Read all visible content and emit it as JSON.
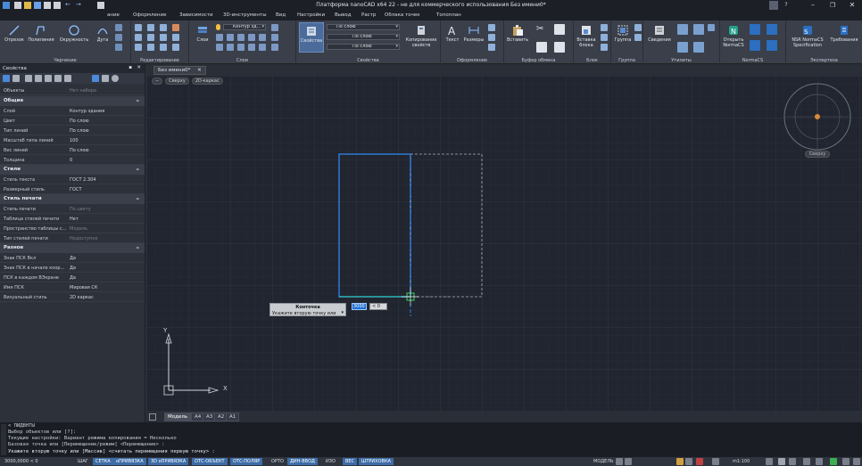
{
  "window": {
    "title": "Платформа nanoCAD x64 22 - не для коммерческого использования Без имени0*"
  },
  "menu": [
    "Черчение",
    "Редактирование",
    "Оформление",
    "Зависимости",
    "3D-инструменты",
    "Вид",
    "Настройки",
    "Вывод",
    "Растр",
    "Облака точек",
    "Топоплан"
  ],
  "menu_visible_tail": "ание",
  "ribbon": {
    "draw": {
      "title": "Черчение",
      "buttons": [
        "Отрезок",
        "Полилиния",
        "Окружность",
        "Дуга"
      ]
    },
    "edit": {
      "title": "Редактирование"
    },
    "layers": {
      "title": "Слои",
      "button": "Слои",
      "layer_combo": "Контур зд..."
    },
    "props": {
      "title": "Свойства",
      "button": "Свойства",
      "combo1": "По слою",
      "combo2": "По слою",
      "combo3": "По слою",
      "copy_button": "Копирование свойств"
    },
    "annot": {
      "title": "Оформление",
      "buttons": [
        "Текст",
        "Размеры"
      ]
    },
    "clip": {
      "title": "Буфер обмена",
      "button": "Вставить"
    },
    "block": {
      "title": "Блок",
      "button": "Вставка блока"
    },
    "group": {
      "title": "Группа",
      "button": "Группа"
    },
    "utils": {
      "title": "Утилиты",
      "button": "Сведения"
    },
    "normacs": {
      "title": "NormaCS",
      "button": "Открыть NormaCS"
    },
    "expertise": {
      "title": "Экспертиза",
      "buttons": [
        "NSR NormaCS Specification",
        "Требования"
      ]
    }
  },
  "properties": {
    "header": "Свойства",
    "selection_label": "Объекты",
    "selection_value": "Нет набора",
    "sections": [
      {
        "name": "Общие",
        "rows": [
          {
            "k": "Слой",
            "v": "Контур здания"
          },
          {
            "k": "Цвет",
            "v": "По слою"
          },
          {
            "k": "Тип линий",
            "v": "По слою"
          },
          {
            "k": "Масштаб типа линий",
            "v": "100"
          },
          {
            "k": "Вес линий",
            "v": "По слою"
          },
          {
            "k": "Толщина",
            "v": "0"
          }
        ]
      },
      {
        "name": "Стили",
        "rows": [
          {
            "k": "Стиль текста",
            "v": "ГОСТ 2.304"
          },
          {
            "k": "Размерный стиль",
            "v": "ГОСТ"
          }
        ]
      },
      {
        "name": "Стиль печати",
        "rows": [
          {
            "k": "Стиль печати",
            "v": "По цвету",
            "dim": true
          },
          {
            "k": "Таблица стилей печати",
            "v": "Нет"
          },
          {
            "k": "Пространство таблицы с...",
            "v": "Модель",
            "dim": true
          },
          {
            "k": "Тип стилей печати",
            "v": "Недоступно",
            "dim": true
          }
        ]
      },
      {
        "name": "Разное",
        "rows": [
          {
            "k": "Знак ПСК Вкл",
            "v": "Да"
          },
          {
            "k": "Знак ПСК в начале коор...",
            "v": "Да"
          },
          {
            "k": "ПСК в каждом ВЭкране",
            "v": "Да"
          },
          {
            "k": "Имя ПСК",
            "v": "Мировая СК"
          },
          {
            "k": "Визуальный стиль",
            "v": "2D каркас"
          }
        ]
      }
    ]
  },
  "doc_tab": "Без имени0*",
  "view_controls": [
    "−",
    "Сверху",
    "2D-каркас"
  ],
  "viewcube_label": "Сверху",
  "tooltip": {
    "title": "Конточка",
    "prompt": "Укажите вторую точку или"
  },
  "dyn_input": {
    "length": "3000",
    "angle": "< 0"
  },
  "layout_tabs": [
    "Модель",
    "A4",
    "A3",
    "A2",
    "A1"
  ],
  "ucs": {
    "x": "X",
    "y": "Y"
  },
  "command_history": [
    "< ПИДВНТЫ",
    "Выбор объектов или [?]:",
    "Текущие настройки: Вариант режима копирования = Несколько",
    "Базовая точка или [Перемещение/режим] <Перемещение> :",
    "Укажите вторую точку или [Массив] <считать перемещения первую точку> :"
  ],
  "status": {
    "coords": "3000,0000 < 0",
    "toggles": [
      {
        "label": "ШАГ",
        "on": false
      },
      {
        "label": "СЕТКА",
        "on": true
      },
      {
        "label": "оПРИВЯЗКА",
        "on": true
      },
      {
        "label": "3D оПРИВЯЗКА",
        "on": true
      },
      {
        "label": "ОТС-ОБЪЕКТ",
        "on": true
      },
      {
        "label": "ОТС-ПОЛЯР",
        "on": true
      },
      {
        "label": "ОРТО",
        "on": false
      },
      {
        "label": "ДИН-ВВОД",
        "on": true
      },
      {
        "label": "ИЗО",
        "on": false
      },
      {
        "label": "ВЕС",
        "on": true
      },
      {
        "label": "ШТРИХОВКА",
        "on": true
      }
    ],
    "space": "МОДЕЛЬ",
    "scale": "m1:100"
  }
}
